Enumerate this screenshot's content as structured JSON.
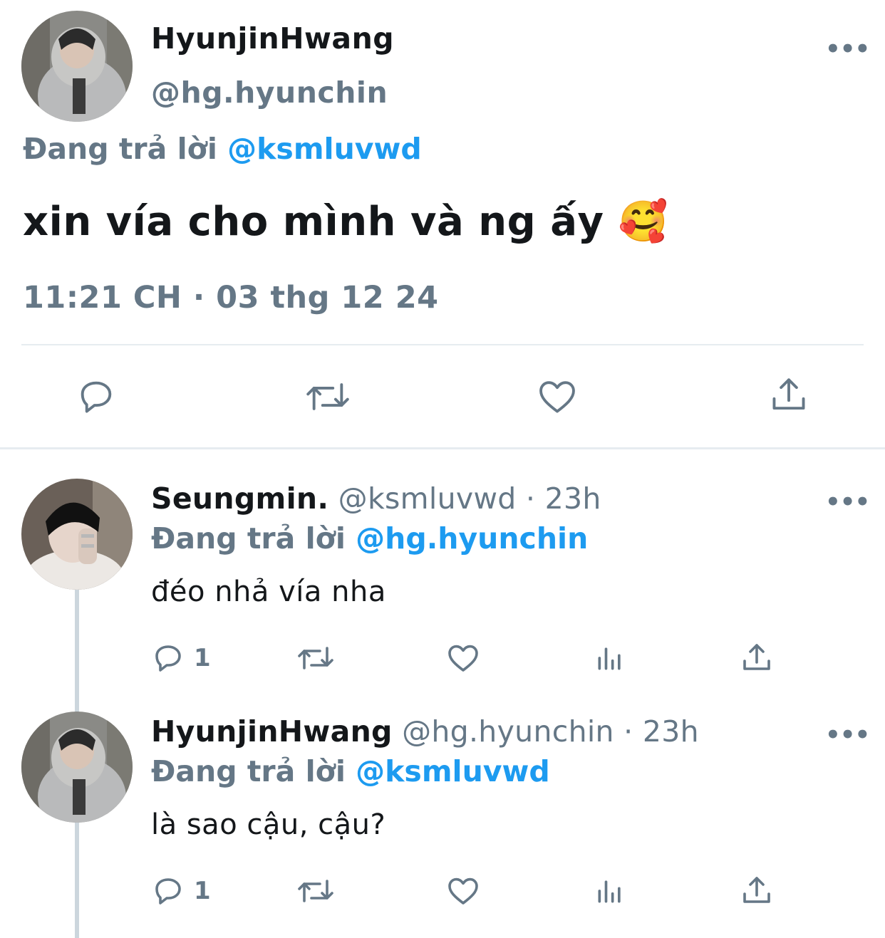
{
  "main_tweet": {
    "display_name": "HyunjinHwang",
    "handle": "@hg.hyunchin",
    "replying_prefix": "Đang trả lời",
    "replying_to": "@ksmluvwd",
    "text": "xin vía cho mình và ng ấy 🥰",
    "timestamp": "11:21 CH · 03 thg 12 24",
    "more": "•••",
    "actions": [
      "reply-icon",
      "retweet-icon",
      "like-icon",
      "share-icon"
    ]
  },
  "replies": [
    {
      "display_name": "Seungmin.",
      "meta": "@ksmluvwd · 23h",
      "replying_prefix": "Đang trả lời",
      "replying_to": "@hg.hyunchin",
      "text": "đéo nhả vía nha",
      "reply_count": "1",
      "more": "•••"
    },
    {
      "display_name": "HyunjinHwang",
      "meta": "@hg.hyunchin · 23h",
      "replying_prefix": "Đang trả lời",
      "replying_to": "@ksmluvwd",
      "text": "là sao cậu, cậu?",
      "reply_count": "1",
      "more": "•••"
    }
  ],
  "colors": {
    "text": "#14171a",
    "secondary": "#657786",
    "link": "#1d9bf0",
    "divider": "#e6ecf0"
  }
}
